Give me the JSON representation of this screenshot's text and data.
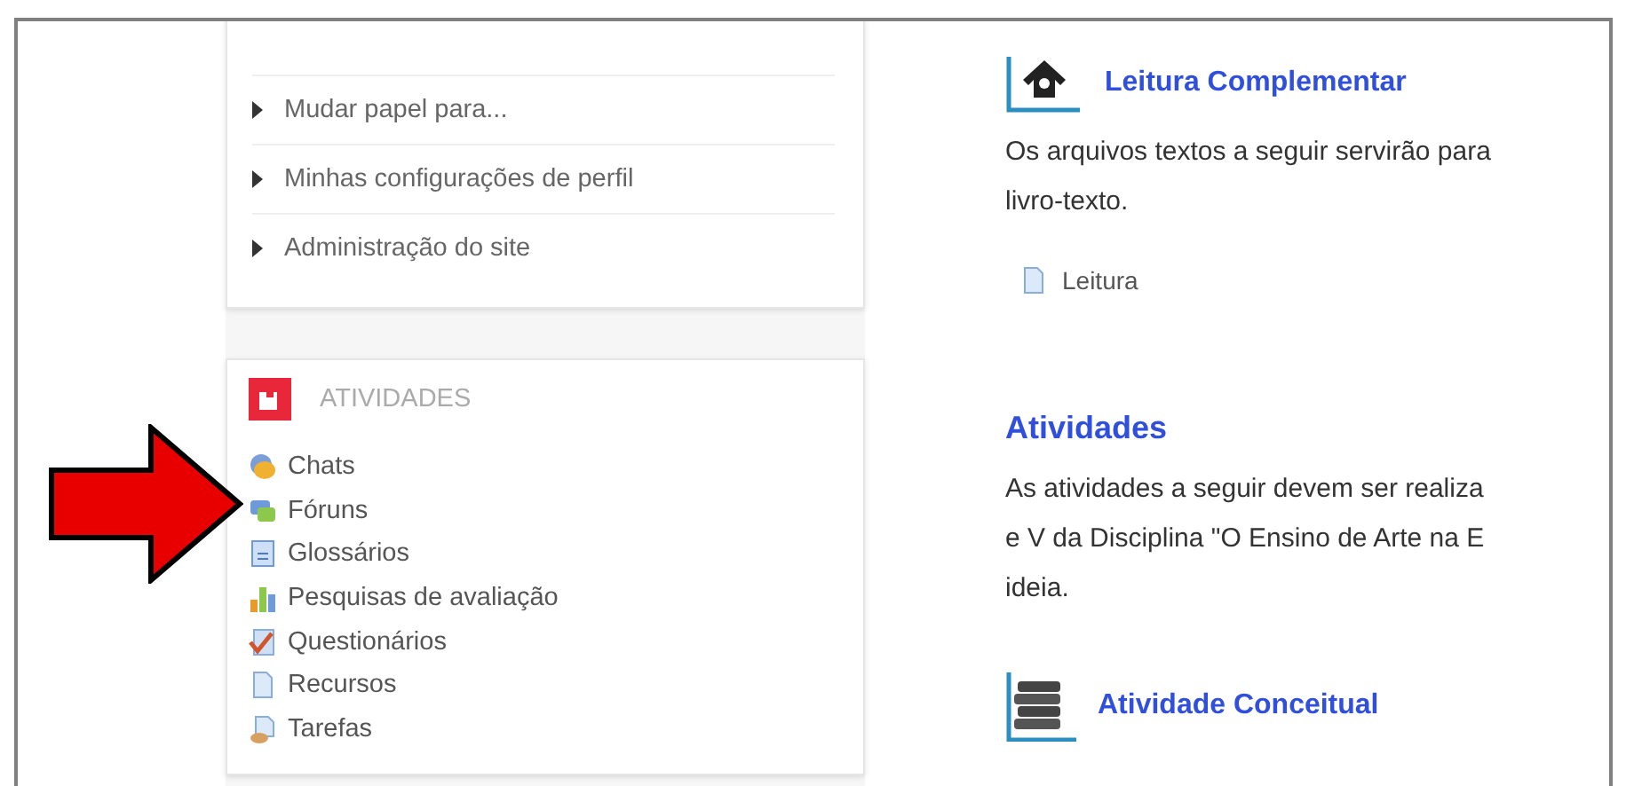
{
  "settings_menu": {
    "items": [
      "Mudar papel para...",
      "Minhas configurações de perfil",
      "Administração do site"
    ]
  },
  "activities_block": {
    "title": "ATIVIDADES",
    "items": [
      {
        "kind": "chat",
        "label": "Chats"
      },
      {
        "kind": "forum",
        "label": "Fóruns"
      },
      {
        "kind": "glossary",
        "label": "Glossários"
      },
      {
        "kind": "survey",
        "label": "Pesquisas de avaliação"
      },
      {
        "kind": "quiz",
        "label": "Questionários"
      },
      {
        "kind": "resource",
        "label": "Recursos"
      },
      {
        "kind": "assignment",
        "label": "Tarefas"
      }
    ]
  },
  "content": [
    {
      "kind": "label",
      "title": "Leitura Complementar"
    },
    {
      "kind": "text",
      "lines": [
        "Os arquivos textos a seguir servirão para",
        "livro-texto."
      ]
    },
    {
      "kind": "resource",
      "title": "Leitura"
    },
    {
      "kind": "heading",
      "title": "Atividades"
    },
    {
      "kind": "text",
      "lines": [
        "As atividades a seguir devem ser realiza",
        "e V da Disciplina \"O Ensino de Arte na E",
        "ideia."
      ]
    },
    {
      "kind": "label",
      "title": "Atividade Conceitual"
    }
  ]
}
